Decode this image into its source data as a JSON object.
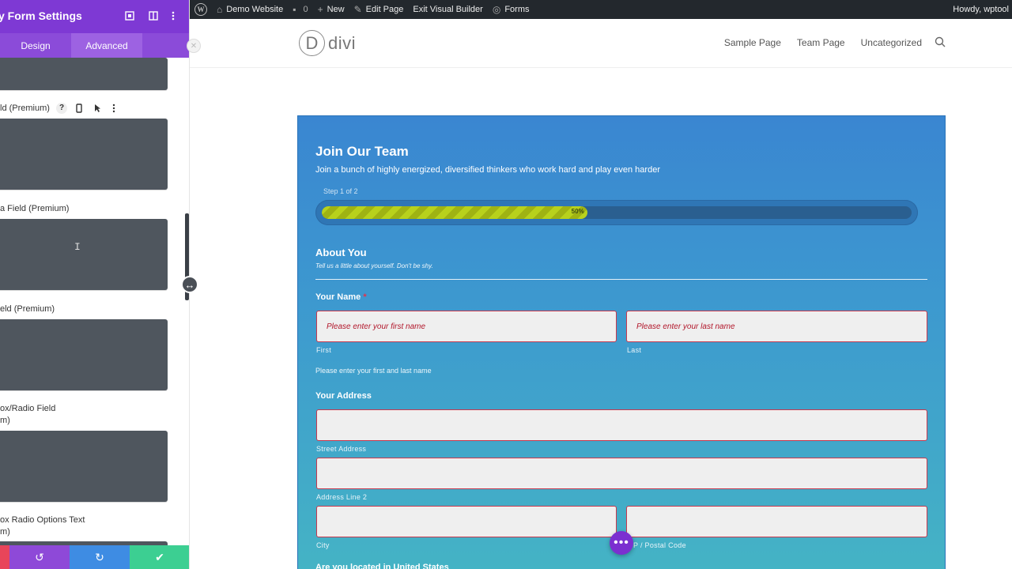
{
  "adminbar": {
    "wp_logo": "W",
    "site_name": "Demo Website",
    "comments_count": "0",
    "new_label": "New",
    "edit_page_label": "Edit Page",
    "exit_builder_label": "Exit Visual Builder",
    "forms_label": "Forms",
    "howdy_label": "Howdy, wptool"
  },
  "site": {
    "logo_letter": "D",
    "logo_text": "divi",
    "nav": [
      "Sample Page",
      "Team Page",
      "Uncategorized"
    ]
  },
  "form": {
    "title": "Join Our Team",
    "description": "Join a bunch of highly energized, diversified thinkers who work hard and play even harder",
    "step_label": "Step 1 of 2",
    "progress_percent": 50,
    "progress_text": "50%",
    "section_title": "About You",
    "section_description": "Tell us a little about yourself. Don't be shy.",
    "name_label": "Your Name",
    "required_mark": "*",
    "first_placeholder": "Please enter your first name",
    "last_placeholder": "Please enter your last name",
    "first_sublabel": "First",
    "last_sublabel": "Last",
    "name_help": "Please enter your first and last name",
    "address_label": "Your Address",
    "street_sublabel": "Street Address",
    "line2_sublabel": "Address Line 2",
    "city_sublabel": "City",
    "zip_sublabel": "P / Postal Code",
    "next_question_cutoff": "Are you located in United States"
  },
  "fab": {
    "label": "•••"
  },
  "panel": {
    "title": "y Form Settings",
    "tabs": [
      "Design",
      "Advanced"
    ],
    "options": [
      "ld (Premium)",
      "a Field (Premium)",
      "eld (Premium)",
      "ox/Radio Field\nm)",
      "ox Radio Options Text\nm)"
    ],
    "accent": "#7e39d4",
    "well_color": "#4f565e"
  },
  "footer": {
    "undo_icon": "↺",
    "redo_icon": "↻",
    "save_icon": "✔"
  }
}
